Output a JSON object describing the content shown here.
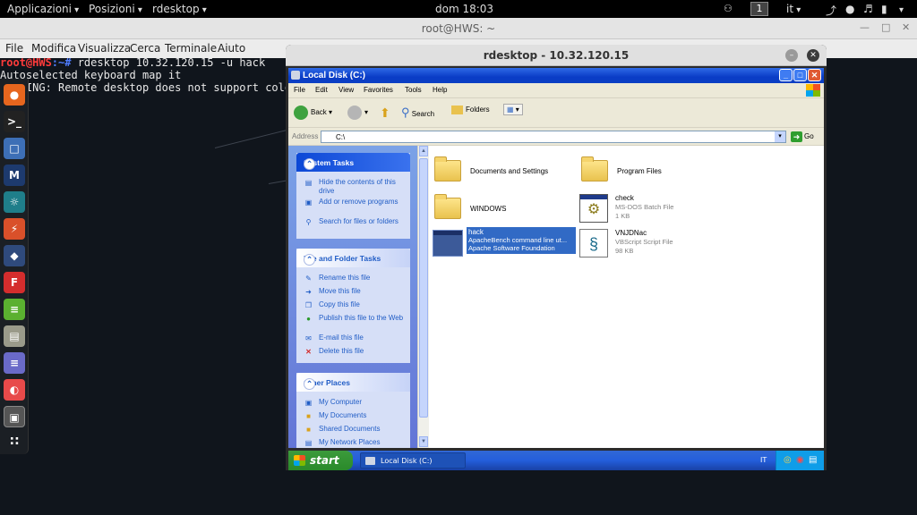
{
  "topbar": {
    "applications": "Applicazioni",
    "places": "Posizioni",
    "app": "rdesktop",
    "clock": "dom 18:03",
    "workspace": "1",
    "language": "it"
  },
  "terminal": {
    "title": "root@HWS: ~",
    "menu": [
      "File",
      "Modifica",
      "Visualizza",
      "Cerca",
      "Terminale",
      "Aiuto"
    ],
    "prompt_user": "root@HWS",
    "prompt_path": ":~# ",
    "command": "rdesktop 10.32.120.15 -u hack",
    "output1": "Autoselected keyboard map it",
    "output2": "WARNING: Remote desktop does not support colour"
  },
  "rdesktop": {
    "title": "rdesktop - 10.32.120.15"
  },
  "explorer": {
    "title": "Local Disk (C:)",
    "menu": [
      "File",
      "Edit",
      "View",
      "Favorites",
      "Tools",
      "Help"
    ],
    "toolbar": {
      "back": "Back",
      "search": "Search",
      "folders": "Folders"
    },
    "address_label": "Address",
    "address_value": "C:\\",
    "go": "Go",
    "system_tasks": {
      "title": "System Tasks",
      "items": [
        "Hide the contents of this drive",
        "Add or remove programs",
        "Search for files or folders"
      ]
    },
    "file_folder_tasks": {
      "title": "File and Folder Tasks",
      "items": [
        "Rename this file",
        "Move this file",
        "Copy this file",
        "Publish this file to the Web",
        "E-mail this file",
        "Delete this file"
      ]
    },
    "other_places": {
      "title": "Other Places",
      "items": [
        "My Computer",
        "My Documents",
        "Shared Documents",
        "My Network Places"
      ]
    },
    "files": [
      {
        "name": "Documents and Settings",
        "type": "folder"
      },
      {
        "name": "Program Files",
        "type": "folder"
      },
      {
        "name": "WINDOWS",
        "type": "folder"
      },
      {
        "name": "check",
        "desc": "MS-DOS Batch File",
        "size": "1 KB",
        "type": "batch"
      },
      {
        "name": "hack",
        "desc": "ApacheBench command line ut...",
        "desc2": "Apache Software Foundation",
        "type": "exe",
        "selected": true
      },
      {
        "name": "VNJDNac",
        "desc": "VBScript Script File",
        "size": "98 KB",
        "type": "vbs"
      }
    ]
  },
  "xp_taskbar": {
    "start": "start",
    "task": "Local Disk (C:)",
    "lang": "IT"
  }
}
